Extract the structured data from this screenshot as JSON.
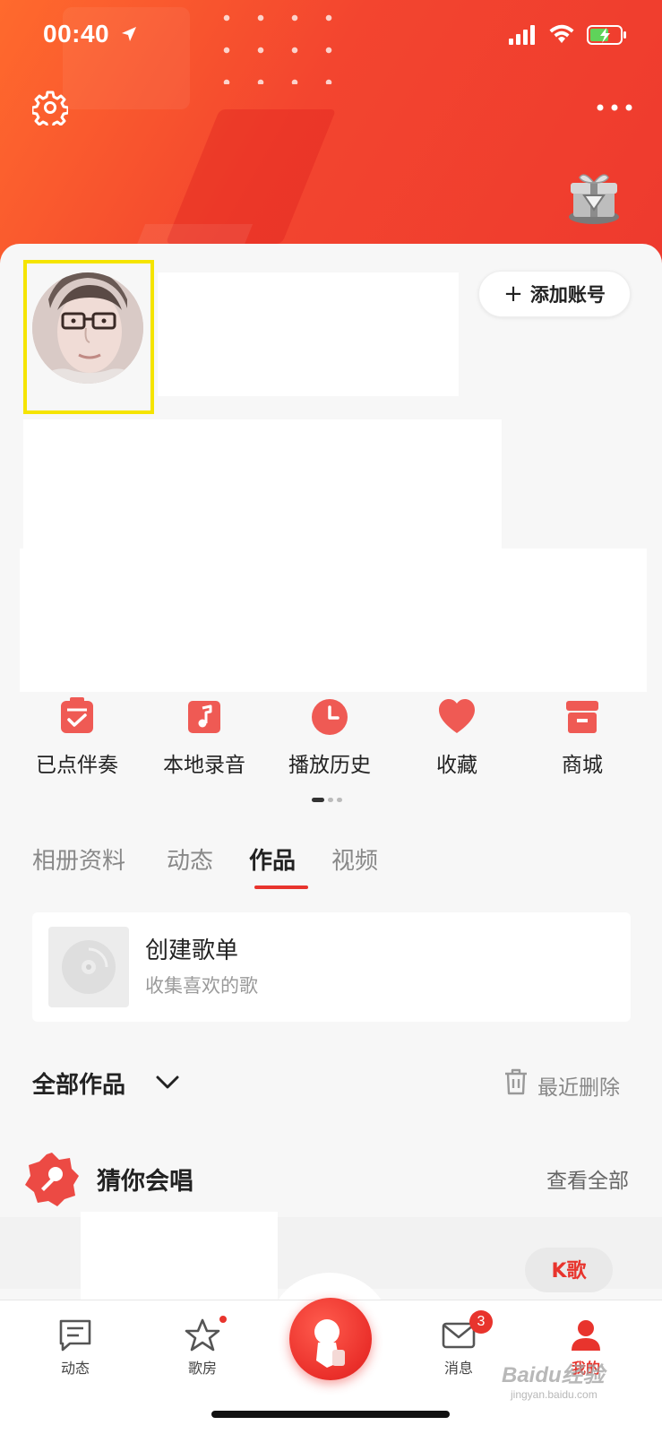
{
  "status_bar": {
    "time": "00:40"
  },
  "header": {
    "settings_icon": "gear-icon",
    "more_icon": "more-dots-icon",
    "gift_icon": "gift-box-icon"
  },
  "profile": {
    "avatar_icon": "user-avatar",
    "add_account_label": "添加账号"
  },
  "quick_actions": [
    {
      "label": "已点伴奏",
      "icon": "checklist-icon"
    },
    {
      "label": "本地录音",
      "icon": "music-note-icon"
    },
    {
      "label": "播放历史",
      "icon": "clock-icon"
    },
    {
      "label": "收藏",
      "icon": "heart-icon"
    },
    {
      "label": "商城",
      "icon": "store-icon"
    }
  ],
  "tabs": [
    {
      "label": "相册资料",
      "active": false
    },
    {
      "label": "动态",
      "active": false
    },
    {
      "label": "作品",
      "active": true
    },
    {
      "label": "视频",
      "active": false
    }
  ],
  "playlist": {
    "title": "创建歌单",
    "subtitle": "收集喜欢的歌"
  },
  "works": {
    "label": "全部作品",
    "recent_deleted": "最近删除"
  },
  "guess": {
    "title": "猜你会唱",
    "view_all": "查看全部",
    "k_button": "K歌"
  },
  "bottom_nav": [
    {
      "label": "动态",
      "icon": "chat-icon",
      "active": false
    },
    {
      "label": "歌房",
      "icon": "star-icon",
      "active": false
    },
    {
      "label": "消息",
      "icon": "mail-icon",
      "active": false,
      "badge": "3"
    },
    {
      "label": "我的",
      "icon": "person-icon",
      "active": true
    }
  ],
  "watermark": {
    "main": "Baidu经验",
    "sub": "jingyan.baidu.com"
  },
  "colors": {
    "accent": "#e8342d",
    "header_start": "#ff6a2d",
    "header_end": "#ee3a2e",
    "highlight_frame": "#f5e400"
  }
}
